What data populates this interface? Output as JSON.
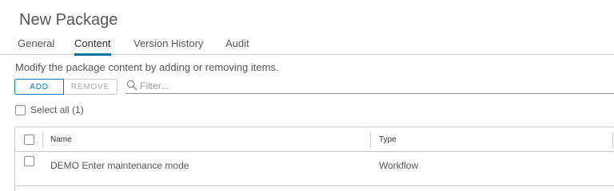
{
  "page": {
    "title": "New Package"
  },
  "tabs": [
    {
      "label": "General",
      "active": false
    },
    {
      "label": "Content",
      "active": true
    },
    {
      "label": "Version History",
      "active": false
    },
    {
      "label": "Audit",
      "active": false
    }
  ],
  "content": {
    "description": "Modify the package content by adding or removing items.",
    "add_label": "ADD",
    "remove_label": "REMOVE",
    "filter_placeholder": "Filter...",
    "select_all_label": "Select all (1)"
  },
  "grid": {
    "columns": [
      "Name",
      "Type"
    ],
    "rows": [
      {
        "name": "DEMO Enter maintenance mode",
        "type": "Workflow"
      }
    ]
  },
  "colors": {
    "accent": "#0072a3",
    "button": "#0079b8",
    "text": "#565656",
    "border": "#cccccc"
  }
}
